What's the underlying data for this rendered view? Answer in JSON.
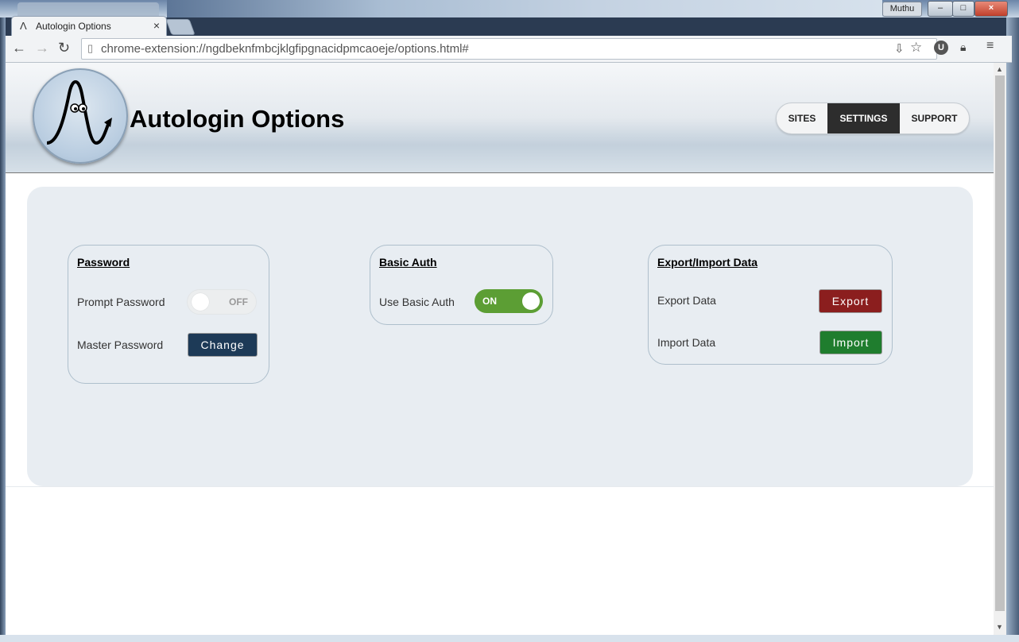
{
  "browser": {
    "tab_title": "Autologin Options",
    "tab_close": "×",
    "user_name": "Muthu",
    "url": "chrome-extension://ngdbeknfmbcjklgfipgnacidpmcaoeje/options.html#",
    "ext_u": "U"
  },
  "header": {
    "title": "Autologin Options",
    "nav": [
      "SITES",
      "SETTINGS",
      "SUPPORT"
    ],
    "active_nav": "SETTINGS"
  },
  "password_card": {
    "title": "Password",
    "prompt_label": "Prompt Password",
    "prompt_state": "OFF",
    "master_label": "Master Password",
    "change_button": "Change"
  },
  "basic_auth_card": {
    "title": "Basic Auth",
    "label": "Use Basic Auth",
    "state": "ON"
  },
  "export_import_card": {
    "title": "Export/Import Data",
    "export_label": "Export Data",
    "export_button": "Export",
    "import_label": "Import Data",
    "import_button": "Import"
  },
  "colors": {
    "change_button": "#1d3a57",
    "export_button": "#8b1e1e",
    "import_button": "#1f7d2e",
    "toggle_on": "#5c9e34",
    "nav_active": "#2d2d2d"
  }
}
